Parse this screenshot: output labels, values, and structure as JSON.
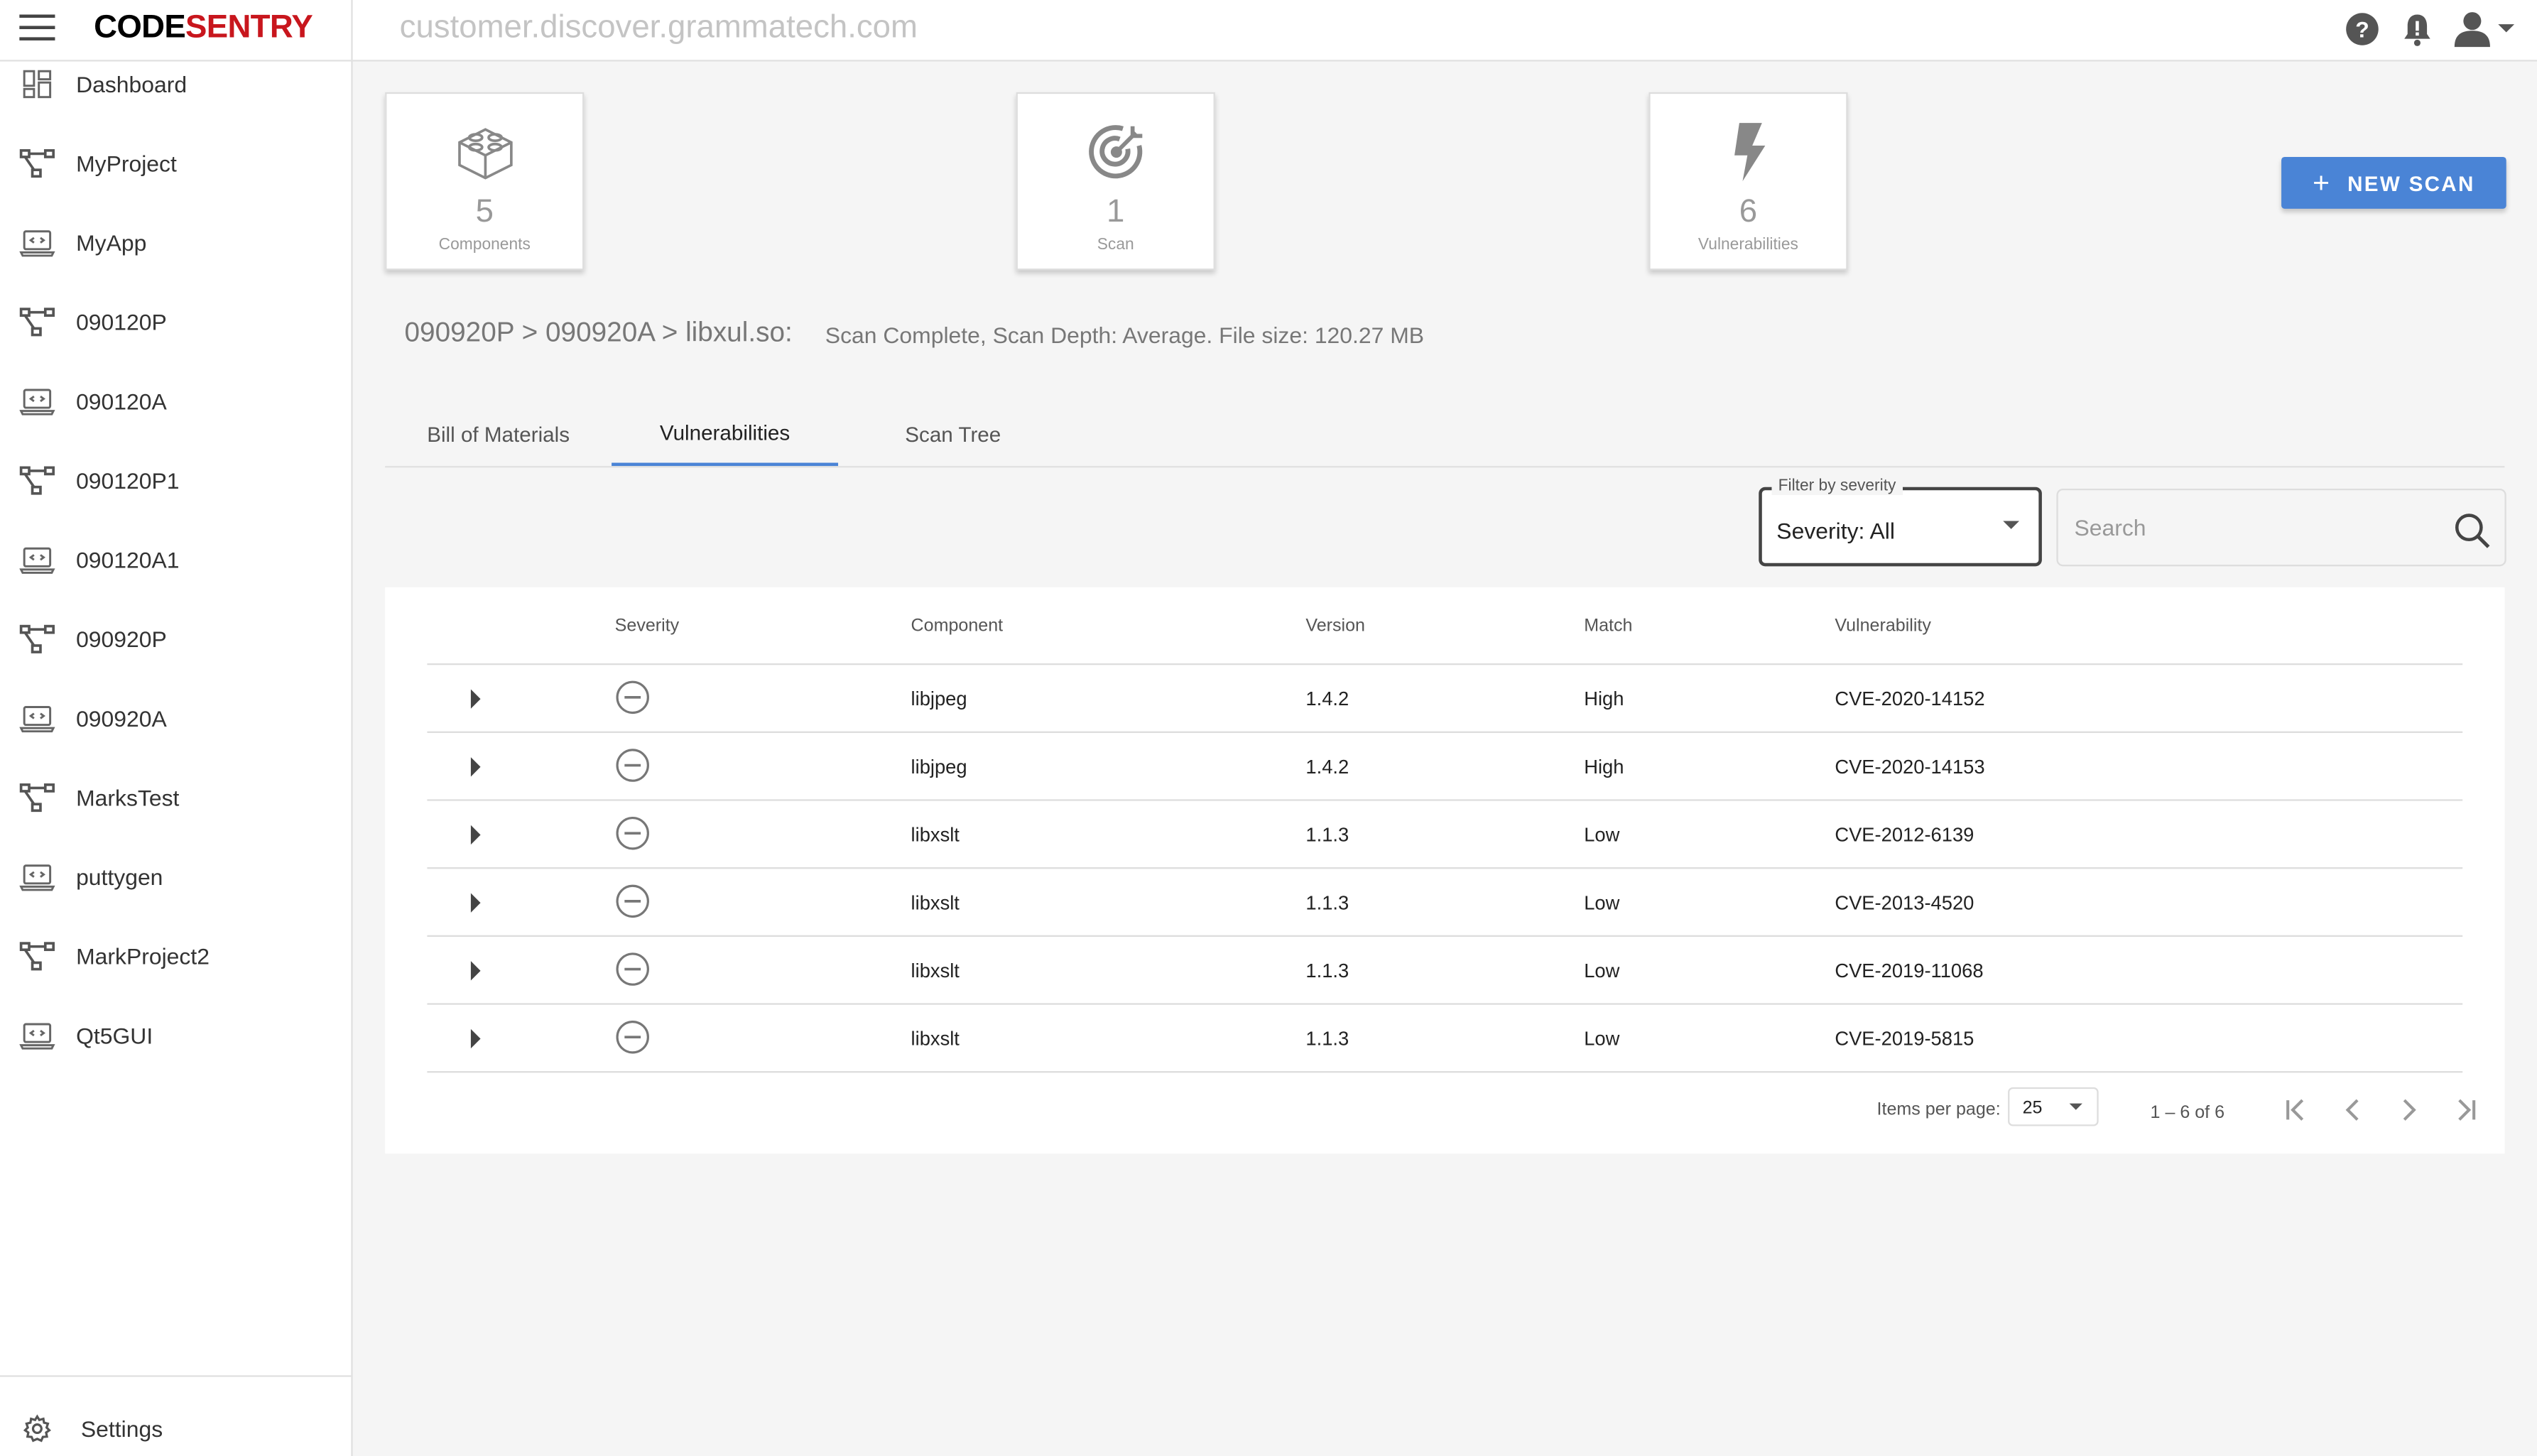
{
  "app": {
    "logo_part1": "CODE",
    "logo_part2": "SENTRY",
    "url": "customer.discover.grammatech.com"
  },
  "colors": {
    "accent": "#4a84d6",
    "brand_red": "#c8161d"
  },
  "sidebar": {
    "items": [
      {
        "label": "Dashboard",
        "icon": "dashboard-icon"
      },
      {
        "label": "MyProject",
        "icon": "project-icon"
      },
      {
        "label": "MyApp",
        "icon": "application-icon"
      },
      {
        "label": "090120P",
        "icon": "project-icon"
      },
      {
        "label": "090120A",
        "icon": "application-icon"
      },
      {
        "label": "090120P1",
        "icon": "project-icon"
      },
      {
        "label": "090120A1",
        "icon": "application-icon"
      },
      {
        "label": "090920P",
        "icon": "project-icon"
      },
      {
        "label": "090920A",
        "icon": "application-icon"
      },
      {
        "label": "MarksTest",
        "icon": "project-icon"
      },
      {
        "label": "puttygen",
        "icon": "application-icon"
      },
      {
        "label": "MarkProject2",
        "icon": "project-icon"
      },
      {
        "label": "Qt5GUI",
        "icon": "application-icon"
      }
    ],
    "settings_label": "Settings"
  },
  "stats": {
    "components": {
      "value": "5",
      "label": "Components"
    },
    "scan": {
      "value": "1",
      "label": "Scan"
    },
    "vulnerabilities": {
      "value": "6",
      "label": "Vulnerabilities"
    }
  },
  "new_scan_label": "NEW SCAN",
  "breadcrumb": "090920P > 090920A > libxul.so:",
  "scan_info": "Scan Complete, Scan Depth: Average. File size: 120.27 MB",
  "tabs": [
    "Bill of Materials",
    "Vulnerabilities",
    "Scan Tree"
  ],
  "filter": {
    "label": "Filter by severity",
    "value": "Severity: All"
  },
  "search": {
    "placeholder": "Search"
  },
  "table": {
    "headers": {
      "severity": "Severity",
      "component": "Component",
      "version": "Version",
      "match": "Match",
      "vulnerability": "Vulnerability"
    },
    "rows": [
      {
        "component": "libjpeg",
        "version": "1.4.2",
        "match": "High",
        "vulnerability": "CVE-2020-14152"
      },
      {
        "component": "libjpeg",
        "version": "1.4.2",
        "match": "High",
        "vulnerability": "CVE-2020-14153"
      },
      {
        "component": "libxslt",
        "version": "1.1.3",
        "match": "Low",
        "vulnerability": "CVE-2012-6139"
      },
      {
        "component": "libxslt",
        "version": "1.1.3",
        "match": "Low",
        "vulnerability": "CVE-2013-4520"
      },
      {
        "component": "libxslt",
        "version": "1.1.3",
        "match": "Low",
        "vulnerability": "CVE-2019-11068"
      },
      {
        "component": "libxslt",
        "version": "1.1.3",
        "match": "Low",
        "vulnerability": "CVE-2019-5815"
      }
    ]
  },
  "pager": {
    "items_per_page_label": "Items per page:",
    "items_per_page": "25",
    "range": "1 – 6 of 6"
  }
}
